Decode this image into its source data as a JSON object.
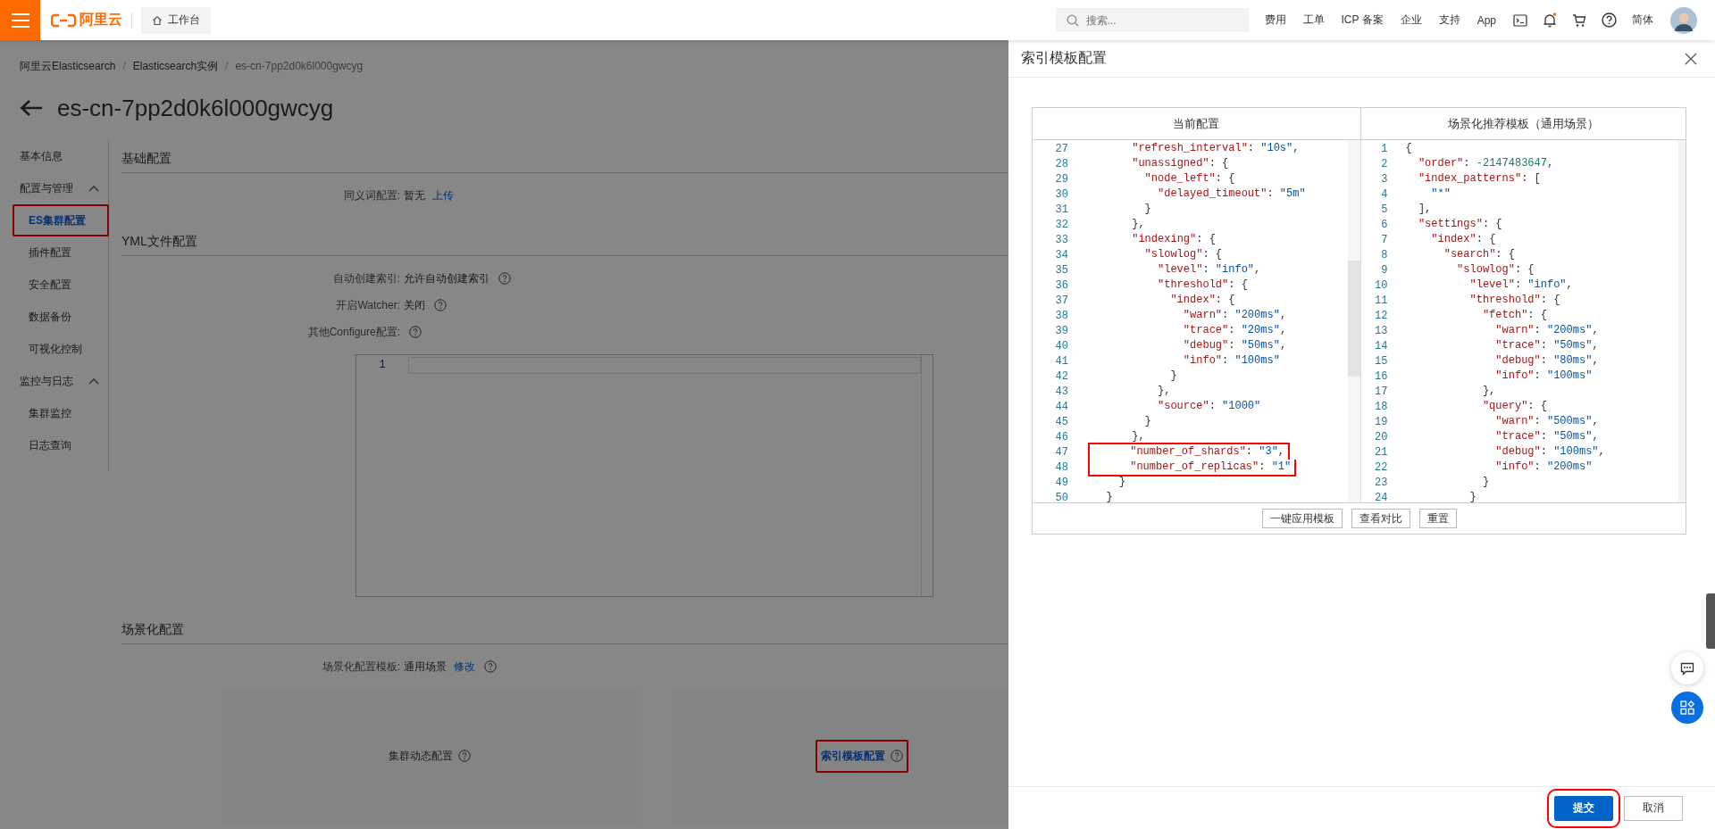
{
  "topbar": {
    "logo": "阿里云",
    "workbench": "工作台",
    "search": {
      "placeholder": "搜索..."
    },
    "links": [
      "费用",
      "工单",
      "ICP 备案",
      "企业",
      "支持",
      "App"
    ],
    "notification_dot": true,
    "language": "简体"
  },
  "breadcrumb": {
    "separator": "/",
    "items": [
      "阿里云Elasticsearch",
      "Elasticsearch实例",
      "es-cn-7pp2d0k6l000gwcyg"
    ]
  },
  "title": "es-cn-7pp2d0k6l000gwcyg",
  "sidebar": [
    {
      "label": "基本信息",
      "kind": "link",
      "selected": false
    },
    {
      "label": "配置与管理",
      "kind": "group",
      "selected": false,
      "expanded": true,
      "children": [
        {
          "label": "ES集群配置",
          "selected": true,
          "marked": true
        },
        {
          "label": "插件配置",
          "selected": false,
          "marked": false
        },
        {
          "label": "安全配置",
          "selected": false,
          "marked": false
        },
        {
          "label": "数据备份",
          "selected": false,
          "marked": false
        },
        {
          "label": "可视化控制",
          "selected": false,
          "marked": false
        }
      ]
    },
    {
      "label": "监控与日志",
      "kind": "group",
      "selected": false,
      "expanded": true,
      "children": [
        {
          "label": "集群监控",
          "selected": false,
          "marked": false
        },
        {
          "label": "日志查询",
          "selected": false,
          "marked": false
        }
      ]
    }
  ],
  "sections": [
    {
      "title": "基础配置",
      "rows": [
        {
          "kind": "field",
          "label": "同义词配置:",
          "value": "暂无",
          "link": "上传",
          "help": false
        }
      ]
    },
    {
      "title": "YML文件配置",
      "rows": [
        {
          "kind": "field",
          "label": "自动创建索引:",
          "value": "允许自动创建索引",
          "help": true
        },
        {
          "kind": "field",
          "label": "开启Watcher:",
          "value": "关闭",
          "help": true
        },
        {
          "kind": "field",
          "label": "其他Configure配置:",
          "help": true
        },
        {
          "kind": "editor",
          "line_numbers": [
            "1"
          ]
        }
      ]
    },
    {
      "title": "场景化配置",
      "rows": [
        {
          "kind": "field",
          "label": "场景化配置模板:",
          "value": "通用场景",
          "link": "修改",
          "help": true
        },
        {
          "kind": "cards",
          "cards": [
            {
              "label": "集群动态配置",
              "link": false,
              "marked": false
            },
            {
              "label": "索引模板配置",
              "link": true,
              "marked": true
            }
          ]
        }
      ]
    }
  ],
  "drawer": {
    "title": "索引模板配置",
    "columns": [
      "当前配置",
      "场景化推荐模板（通用场景）"
    ],
    "left_code": [
      {
        "no": "27",
        "code": "      \"refresh_interval\": \"10s\",",
        "marked": false
      },
      {
        "no": "28",
        "code": "      \"unassigned\": {",
        "marked": false
      },
      {
        "no": "29",
        "code": "        \"node_left\": {",
        "marked": false
      },
      {
        "no": "30",
        "code": "          \"delayed_timeout\": \"5m\"",
        "marked": false
      },
      {
        "no": "31",
        "code": "        }",
        "marked": false
      },
      {
        "no": "32",
        "code": "      },",
        "marked": false
      },
      {
        "no": "33",
        "code": "      \"indexing\": {",
        "marked": false
      },
      {
        "no": "34",
        "code": "        \"slowlog\": {",
        "marked": false
      },
      {
        "no": "35",
        "code": "          \"level\": \"info\",",
        "marked": false
      },
      {
        "no": "36",
        "code": "          \"threshold\": {",
        "marked": false
      },
      {
        "no": "37",
        "code": "            \"index\": {",
        "marked": false
      },
      {
        "no": "38",
        "code": "              \"warn\": \"200ms\",",
        "marked": false
      },
      {
        "no": "39",
        "code": "              \"trace\": \"20ms\",",
        "marked": false
      },
      {
        "no": "40",
        "code": "              \"debug\": \"50ms\",",
        "marked": false
      },
      {
        "no": "41",
        "code": "              \"info\": \"100ms\"",
        "marked": false
      },
      {
        "no": "42",
        "code": "            }",
        "marked": false
      },
      {
        "no": "43",
        "code": "          },",
        "marked": false
      },
      {
        "no": "44",
        "code": "          \"source\": \"1000\"",
        "marked": false
      },
      {
        "no": "45",
        "code": "        }",
        "marked": false
      },
      {
        "no": "46",
        "code": "      },",
        "marked": false
      },
      {
        "no": "47",
        "code": "      \"number_of_shards\": \"3\",",
        "marked": true
      },
      {
        "no": "48",
        "code": "      \"number_of_replicas\": \"1\"",
        "marked": true
      },
      {
        "no": "49",
        "code": "    }",
        "marked": false
      },
      {
        "no": "50",
        "code": "  }",
        "marked": false
      }
    ],
    "right_code": [
      {
        "no": "1",
        "code": "{"
      },
      {
        "no": "2",
        "code": "  \"order\": -2147483647,"
      },
      {
        "no": "3",
        "code": "  \"index_patterns\": ["
      },
      {
        "no": "4",
        "code": "    \"*\""
      },
      {
        "no": "5",
        "code": "  ],"
      },
      {
        "no": "6",
        "code": "  \"settings\": {"
      },
      {
        "no": "7",
        "code": "    \"index\": {"
      },
      {
        "no": "8",
        "code": "      \"search\": {"
      },
      {
        "no": "9",
        "code": "        \"slowlog\": {"
      },
      {
        "no": "10",
        "code": "          \"level\": \"info\","
      },
      {
        "no": "11",
        "code": "          \"threshold\": {"
      },
      {
        "no": "12",
        "code": "            \"fetch\": {"
      },
      {
        "no": "13",
        "code": "              \"warn\": \"200ms\","
      },
      {
        "no": "14",
        "code": "              \"trace\": \"50ms\","
      },
      {
        "no": "15",
        "code": "              \"debug\": \"80ms\","
      },
      {
        "no": "16",
        "code": "              \"info\": \"100ms\""
      },
      {
        "no": "17",
        "code": "            },"
      },
      {
        "no": "18",
        "code": "            \"query\": {"
      },
      {
        "no": "19",
        "code": "              \"warn\": \"500ms\","
      },
      {
        "no": "20",
        "code": "              \"trace\": \"50ms\","
      },
      {
        "no": "21",
        "code": "              \"debug\": \"100ms\","
      },
      {
        "no": "22",
        "code": "              \"info\": \"200ms\""
      },
      {
        "no": "23",
        "code": "            }"
      },
      {
        "no": "24",
        "code": "          }"
      }
    ],
    "compare_buttons": [
      "一键应用模板",
      "查看对比",
      "重置"
    ],
    "footer_buttons": [
      {
        "label": "提交",
        "kind": "primary",
        "marked": true
      },
      {
        "label": "取消",
        "kind": "default",
        "marked": false
      }
    ]
  }
}
